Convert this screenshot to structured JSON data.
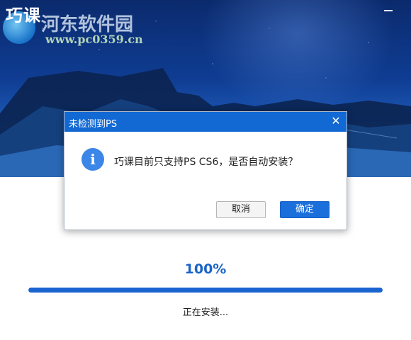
{
  "app": {
    "title": "巧课"
  },
  "watermark": {
    "site_name": "河东软件园",
    "url": "www.pc0359.cn"
  },
  "dialog": {
    "title": "未检测到PS",
    "message": "巧课目前只支持PS CS6，是否自动安装？",
    "cancel_label": "取消",
    "ok_label": "确定",
    "icon": "info-icon"
  },
  "progress": {
    "percent_text": "100%",
    "value": 1.0,
    "status": "正在安装..."
  },
  "colors": {
    "accent": "#1a6fdb",
    "titlebar": "#1269d3",
    "progress": "#1a64d0"
  }
}
